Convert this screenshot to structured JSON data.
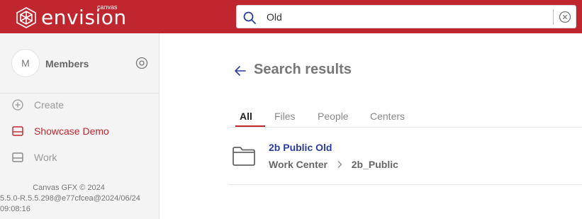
{
  "header": {
    "brand": "envision",
    "brand_sup": "canvas",
    "search_value": "Old",
    "color": "#c0262e"
  },
  "sidebar": {
    "avatar_initial": "M",
    "member_label": "Members",
    "items": [
      {
        "label": "Create",
        "icon": "plus-circle-icon",
        "active": false
      },
      {
        "label": "Showcase Demo",
        "icon": "panel-icon",
        "active": true
      },
      {
        "label": "Work",
        "icon": "panel-icon",
        "active": false
      }
    ],
    "footer_line1": "Canvas GFX © 2024",
    "footer_line2": "5.5.0-R.5.5.298@e77cfcea@2024/06/24",
    "footer_line3": "09:08:16"
  },
  "main": {
    "title": "Search results",
    "tabs": [
      {
        "label": "All",
        "active": true
      },
      {
        "label": "Files",
        "active": false
      },
      {
        "label": "People",
        "active": false
      },
      {
        "label": "Centers",
        "active": false
      }
    ],
    "results": [
      {
        "name": "2b Public Old",
        "path": [
          "Work Center",
          "2b_Public"
        ],
        "icon": "folder-icon"
      }
    ]
  }
}
